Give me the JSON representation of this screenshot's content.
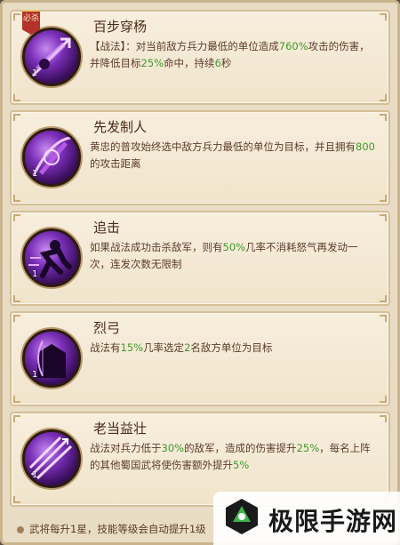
{
  "skills": [
    {
      "title": "百步穿杨",
      "badge": "必杀",
      "level": "1",
      "icon": "arrow-strike-icon",
      "desc_parts": [
        {
          "t": "【战法】：对当前敌方兵力最低的单位造成",
          "hl": false
        },
        {
          "t": "760%",
          "hl": true
        },
        {
          "t": "攻击的伤害，并降低目标",
          "hl": false
        },
        {
          "t": "25%",
          "hl": true
        },
        {
          "t": "命中，持续",
          "hl": false
        },
        {
          "t": "6",
          "hl": true
        },
        {
          "t": "秒",
          "hl": false
        }
      ]
    },
    {
      "title": "先发制人",
      "level": "1",
      "icon": "crosshair-icon",
      "desc_parts": [
        {
          "t": "黄忠的普攻始终选中敌方兵力最低的单位为目标，并且拥有",
          "hl": false
        },
        {
          "t": "800",
          "hl": true
        },
        {
          "t": "的攻击距离",
          "hl": false
        }
      ]
    },
    {
      "title": "追击",
      "level": "1",
      "icon": "running-warrior-icon",
      "desc_parts": [
        {
          "t": "如果战法成功击杀敌军，则有",
          "hl": false
        },
        {
          "t": "50%",
          "hl": true
        },
        {
          "t": "几率不消耗怒气再发动一次，连发次数无限制",
          "hl": false
        }
      ]
    },
    {
      "title": "烈弓",
      "level": "1",
      "icon": "archer-silhouette-icon",
      "desc_parts": [
        {
          "t": "战法有",
          "hl": false
        },
        {
          "t": "15%",
          "hl": true
        },
        {
          "t": "几率选定",
          "hl": false
        },
        {
          "t": "2",
          "hl": true
        },
        {
          "t": "名敌方单位为目标",
          "hl": false
        }
      ]
    },
    {
      "title": "老当益壮",
      "level": "1",
      "icon": "triple-arrow-icon",
      "desc_parts": [
        {
          "t": "战法对兵力低于",
          "hl": false
        },
        {
          "t": "30%",
          "hl": true
        },
        {
          "t": "的敌军，造成的伤害提升",
          "hl": false
        },
        {
          "t": "25%",
          "hl": true
        },
        {
          "t": "，每名上阵的其他蜀国武将使伤害额外提升",
          "hl": false
        },
        {
          "t": "5%",
          "hl": true
        }
      ]
    }
  ],
  "footer": {
    "text": "武将每升1星，技能等级会自动提升1级"
  },
  "watermark": {
    "text": "极限手游网"
  },
  "colors": {
    "highlight": "#3f9a2c",
    "text": "#5b3d2a",
    "title": "#4a2a18"
  }
}
